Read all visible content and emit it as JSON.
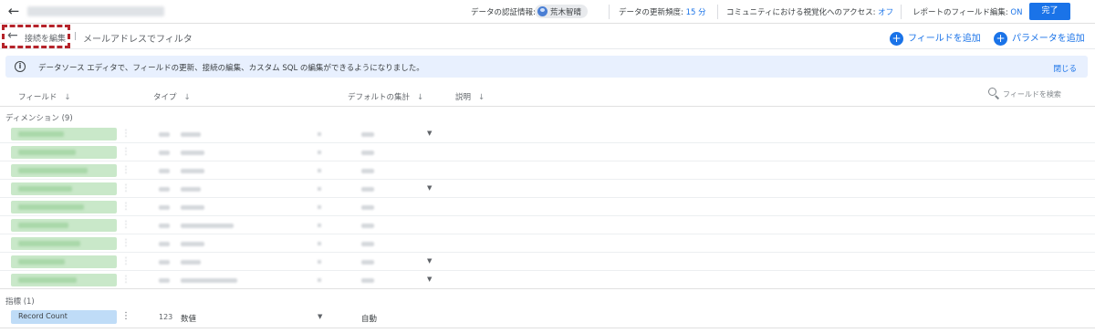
{
  "topbar": {
    "credentials_label": "データの認証情報:",
    "credentials_user": "荒木智晴",
    "freshness_label": "データの更新頻度:",
    "freshness_value": "15 分",
    "community_label": "コミュニティにおける視覚化へのアクセス:",
    "community_value": "オフ",
    "report_edit_label": "レポートのフィールド編集:",
    "report_edit_value": "ON",
    "done_label": "完了"
  },
  "subbar": {
    "edit_connection": "接続を編集",
    "source_name": "メールアドレスでフィルタ",
    "add_field": "フィールドを追加",
    "add_parameter": "パラメータを追加"
  },
  "banner": {
    "text": "データソース エディタで、フィールドの更新、接続の編集、カスタム SQL の編集ができるようになりました。",
    "close": "閉じる"
  },
  "columns": {
    "field": "フィールド",
    "type": "タイプ",
    "default_agg": "デフォルトの集計",
    "description": "説明",
    "search_placeholder": "フィールドを検索"
  },
  "sections": {
    "dimensions": "ディメンション (9)",
    "metrics": "指標 (1)"
  },
  "dimension_rows": [
    {
      "has_caret": true
    },
    {
      "has_caret": false
    },
    {
      "has_caret": false
    },
    {
      "has_caret": true
    },
    {
      "has_caret": false
    },
    {
      "has_caret": false
    },
    {
      "has_caret": false
    },
    {
      "has_caret": true
    },
    {
      "has_caret": true
    }
  ],
  "metric": {
    "name": "Record Count",
    "type_icon": "123",
    "type": "数値",
    "aggregation": "自動"
  },
  "icons": {
    "back": "arrow-left-icon",
    "info": "info-icon",
    "search": "search-icon",
    "add": "plus-circle-icon"
  },
  "colors": {
    "accent": "#1a73e8",
    "banner_bg": "#e8f0fe",
    "dimension_pill": "#c9e8c9",
    "metric_pill": "#bfdcf7",
    "highlight": "#b5232a"
  }
}
